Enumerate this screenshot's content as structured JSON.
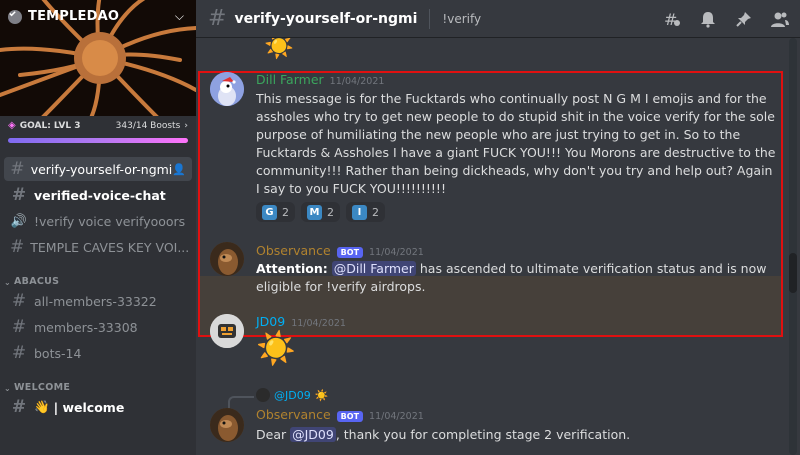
{
  "server": {
    "name": "TEMPLEDAO",
    "goal_label": "GOAL: LVL 3",
    "boosts": "343/14 Boosts"
  },
  "sidebar": {
    "channels": [
      {
        "label": "verify-yourself-or-ngmi",
        "kind": "text"
      },
      {
        "label": "verified-voice-chat",
        "kind": "text"
      },
      {
        "label": "!verify voice verifyooors",
        "kind": "voice"
      },
      {
        "label": "TEMPLE CAVES KEY VOI...",
        "kind": "text"
      }
    ],
    "categories": [
      {
        "name": "ABACUS",
        "channels": [
          "all-members-33322",
          "members-33308",
          "bots-14"
        ]
      },
      {
        "name": "WELCOME",
        "channels": [
          "| welcome"
        ]
      }
    ]
  },
  "header": {
    "channel": "verify-yourself-or-ngmi",
    "topic": "!verify"
  },
  "messages": [
    {
      "author": "Dill Farmer",
      "author_color": "#3ba55d",
      "timestamp": "11/04/2021",
      "text": "This message is for the Fucktards who continually post N G M I emojis and for the assholes who try to get new people to do stupid shit in the voice verify for the sole purpose of humiliating the new people who are just trying to get in. So to the Fucktards & Assholes I have a giant FUCK YOU!!! You Morons are destructive to the community!!! Rather than being dickheads, why don't you try and help out? Again I say to you FUCK YOU!!!!!!!!!!",
      "reactions": [
        {
          "letter": "G",
          "count": "2"
        },
        {
          "letter": "M",
          "count": "2"
        },
        {
          "letter": "I",
          "count": "2"
        }
      ]
    },
    {
      "author": "Observance",
      "author_color": "#b0822f",
      "bot_tag": "BOT",
      "timestamp": "11/04/2021",
      "bold_prefix": "Attention:",
      "mention": "@Dill Farmer",
      "text": "has ascended to ultimate verification status and is now eligible for !verify airdrops."
    },
    {
      "author": "JD09",
      "author_color": "#00aff4",
      "timestamp": "11/04/2021"
    },
    {
      "reply_to": "@JD09",
      "author": "Observance",
      "author_color": "#b0822f",
      "bot_tag": "BOT",
      "timestamp": "11/04/2021",
      "text_prefix": "Dear",
      "mention": "@JD09",
      "text": ", thank you for completing stage 2 verification."
    }
  ]
}
